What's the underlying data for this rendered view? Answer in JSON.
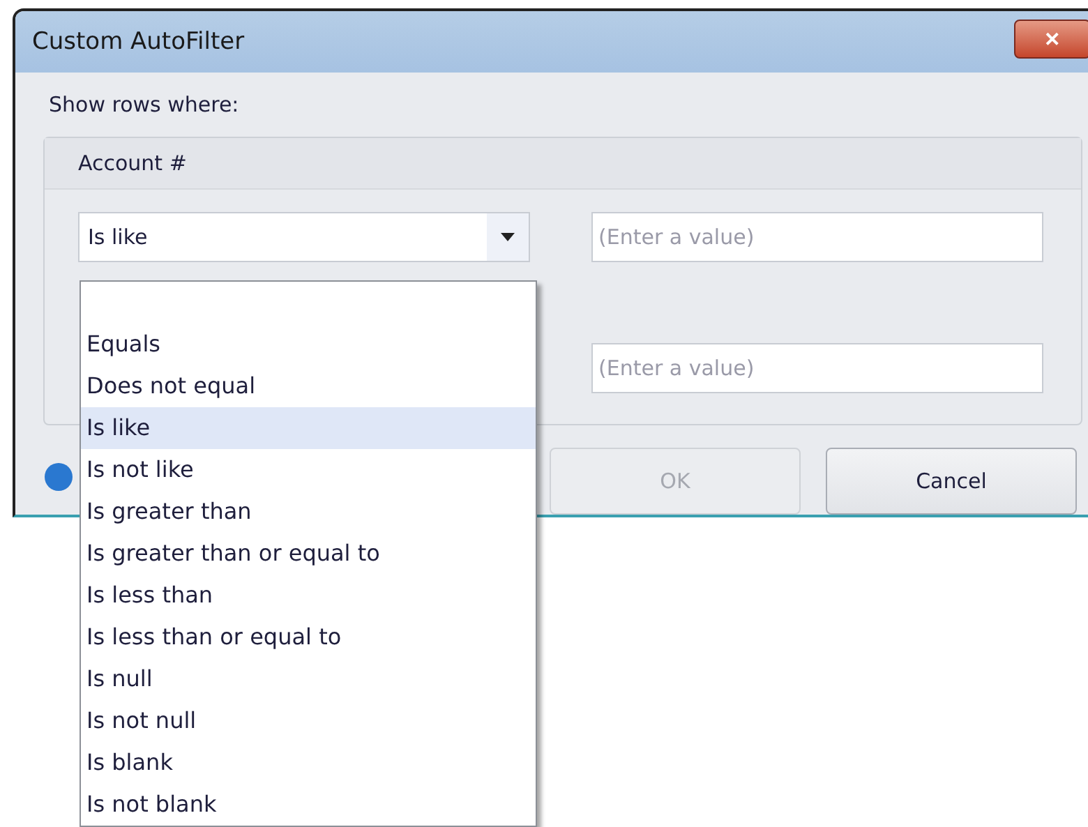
{
  "window": {
    "title": "Custom AutoFilter",
    "close": "✕"
  },
  "prompt": "Show rows where:",
  "group": {
    "title": "Account #"
  },
  "condition_1": {
    "operator": "Is like",
    "value": {
      "placeholder": "(Enter a value)"
    }
  },
  "condition_2": {
    "value": {
      "placeholder": "(Enter a value)"
    }
  },
  "dropdown": {
    "open": true,
    "items": [
      {
        "label": "Equals",
        "selected": false
      },
      {
        "label": "Does not equal",
        "selected": false
      },
      {
        "label": "Is like",
        "selected": true
      },
      {
        "label": "Is not like",
        "selected": false
      },
      {
        "label": "Is greater than",
        "selected": false
      },
      {
        "label": "Is greater than or equal to",
        "selected": false
      },
      {
        "label": "Is less than",
        "selected": false
      },
      {
        "label": "Is less than or equal to",
        "selected": false
      },
      {
        "label": "Is null",
        "selected": false
      },
      {
        "label": "Is not null",
        "selected": false
      },
      {
        "label": "Is blank",
        "selected": false
      },
      {
        "label": "Is not blank",
        "selected": false
      }
    ]
  },
  "buttons": [
    {
      "label": "OK",
      "disabled": true
    },
    {
      "label": "Cancel",
      "disabled": false
    }
  ]
}
